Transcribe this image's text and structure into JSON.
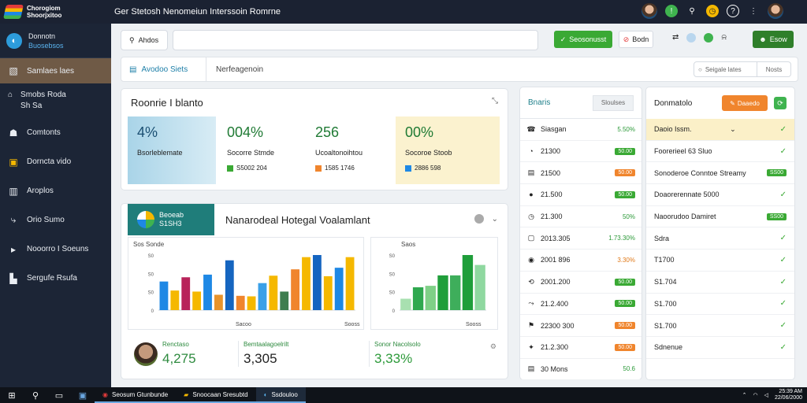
{
  "app": {
    "logo_line1": "Chorogiom",
    "logo_line2": "Shoorjxitoo",
    "title": "Ger Stetosh Nenomeiun Interssoin Romrne"
  },
  "topbar": {
    "icons": [
      "user-icon",
      "alert-icon",
      "pin-icon",
      "clock-icon",
      "help-icon",
      "more-icon"
    ]
  },
  "sidebar": {
    "user_name": "Donnotn",
    "user_sub": "Buosebsos",
    "items": [
      {
        "label": "Samlaes laes",
        "icon": "chart-icon"
      },
      {
        "label": "Smobs Roda",
        "label2": "Sh Sa",
        "icon": "inbox-icon"
      },
      {
        "label": "Comtonts",
        "icon": "users-icon"
      },
      {
        "label": "Dorncta vido",
        "icon": "image-icon"
      },
      {
        "label": "Aroplos",
        "icon": "bar-icon"
      },
      {
        "label": "Orio Sumo",
        "icon": "route-icon"
      },
      {
        "label": "Nooorro I Soeuns",
        "icon": "play-icon"
      },
      {
        "label": "Sergufe Rsufa",
        "icon": "building-icon"
      }
    ]
  },
  "toolbar": {
    "search_scope": "Ahdos",
    "search_placeholder": "",
    "primary_button": "Seosonusst",
    "secondary_button": "Bodn",
    "account_button": "Esow"
  },
  "tabs": {
    "tab1": "Avodoo Siets",
    "tab2": "Nerfeagenoin",
    "search_label": "Seigale lates",
    "search_right": "Nosts"
  },
  "report": {
    "title": "Roonrie I blanto",
    "kpis": [
      {
        "value": "4%",
        "label": "Bsorleblemate",
        "sub": ""
      },
      {
        "value": "004%",
        "label": "Socorre Stmde",
        "sub": "S5002 204"
      },
      {
        "value": "256",
        "label": "Ucoaltonoihtou",
        "sub": "1585 1746"
      },
      {
        "value": "00%",
        "label": "Socoroe Stoob",
        "sub": "2886 598"
      }
    ]
  },
  "chart": {
    "head_line1": "Beoeab",
    "head_line2": "S1SH3",
    "title": "Nanarodeal Hotegal Voalamlant",
    "plot1_title": "Sos Sonde",
    "plot1_xlabel1": "Sacoo",
    "plot1_xlabel2": "Sooss",
    "plot2_title": "Saos",
    "plot2_xlabel": "Sooss",
    "y_ticks1": [
      "S0",
      "S0",
      "S0",
      "0"
    ],
    "y_ticks2": [
      "S0",
      "S0",
      "S0",
      "0"
    ]
  },
  "chart_data": [
    {
      "type": "bar",
      "title": "Sos Sonde",
      "xlabel": "Sacoo",
      "ylabel": "",
      "ylim": [
        0,
        100
      ],
      "categories": [
        "1",
        "2",
        "3",
        "4",
        "5",
        "6",
        "7",
        "8",
        "9",
        "10",
        "11",
        "12",
        "13",
        "14",
        "15",
        "16",
        "17",
        "18"
      ],
      "values": [
        54,
        37,
        62,
        35,
        67,
        29,
        94,
        27,
        26,
        51,
        65,
        35,
        77,
        100,
        104,
        64,
        80,
        100
      ],
      "colors": [
        "#1e88e5",
        "#f5b800",
        "#b8235a",
        "#f5b800",
        "#1e88e5",
        "#e8932b",
        "#1565c0",
        "#f0852d",
        "#f5b800",
        "#3aa0e8",
        "#f5b800",
        "#3e7d4f",
        "#f0852d",
        "#f5b800",
        "#1565c0",
        "#f5b800",
        "#1e88e5",
        "#f5b800"
      ]
    },
    {
      "type": "bar",
      "title": "Saos",
      "xlabel": "Sooss",
      "ylabel": "",
      "ylim": [
        0,
        100
      ],
      "categories": [
        "1",
        "2",
        "3",
        "4",
        "5",
        "6",
        "7"
      ],
      "values": [
        23,
        46,
        49,
        70,
        70,
        111,
        91
      ],
      "colors": [
        "#a8e0b0",
        "#2fa84f",
        "#7fd087",
        "#1f9e3a",
        "#3eae5b",
        "#1f9e3a",
        "#8fd8a0"
      ]
    }
  ],
  "stats": [
    {
      "title": "Renctaso",
      "value": "4,275",
      "color": "#2d8a3e"
    },
    {
      "title": "Bemtaalagoelrilt",
      "value": "3,305",
      "color": "#222222"
    },
    {
      "title": "Sonor Nacolsolo",
      "value": "3,33%",
      "color": "#2d9a3a"
    }
  ],
  "list": {
    "title": "Bnaris",
    "head_button": "Sloulses",
    "rows": [
      {
        "icon": "☎",
        "name": "Siasgan",
        "value": "5.50%",
        "kind": "text-green"
      },
      {
        "icon": "◔",
        "name": "21300",
        "value": "50.00",
        "kind": "badge-green"
      },
      {
        "icon": "▤",
        "name": "21500",
        "value": "50.00",
        "kind": "badge-orange"
      },
      {
        "icon": "●",
        "name": "21.500",
        "value": "50.00",
        "kind": "badge-green"
      },
      {
        "icon": "◷",
        "name": "21.300",
        "value": "50%",
        "kind": "text-green"
      },
      {
        "icon": "▢",
        "name": "2013.305",
        "value": "1.73.30%",
        "kind": "text-green"
      },
      {
        "icon": "◉",
        "name": "2001 896",
        "value": "3.30%",
        "kind": "text-orange"
      },
      {
        "icon": "⟲",
        "name": "2001.200",
        "value": "50.00",
        "kind": "badge-green"
      },
      {
        "icon": "⤳",
        "name": "21.2.400",
        "value": "50.00",
        "kind": "badge-green"
      },
      {
        "icon": "⚑",
        "name": "22300 300",
        "value": "50.00",
        "kind": "badge-orange"
      },
      {
        "icon": "✦",
        "name": "21.2.300",
        "value": "50.00",
        "kind": "badge-orange"
      },
      {
        "icon": "▤",
        "name": "30 Mons",
        "value": "50.6",
        "kind": "text-green"
      }
    ]
  },
  "right": {
    "title": "Donmatolo",
    "orange_button": "Daaedo",
    "rows": [
      {
        "name": "Daoio Issm.",
        "badge": "",
        "check": "✓",
        "hl": true
      },
      {
        "name": "Foorerieel 63 Sluo",
        "badge": "",
        "check": "✓",
        "hl": false
      },
      {
        "name": "Sonoderoe Conntoe Streamy",
        "badge": "SS00",
        "check": "",
        "hl": false
      },
      {
        "name": "Doaorerennate 5000",
        "badge": "",
        "check": "✓",
        "hl": false
      },
      {
        "name": "Naoorudoo Damiret",
        "badge": "SS00",
        "check": "",
        "hl": false
      },
      {
        "name": "Sdra",
        "badge": "",
        "check": "✓",
        "hl": false
      },
      {
        "name": "T1700",
        "badge": "",
        "check": "✓",
        "hl": false
      },
      {
        "name": "S1.704",
        "badge": "",
        "check": "✓",
        "hl": false
      },
      {
        "name": "S1.700",
        "badge": "",
        "check": "✓",
        "hl": false
      },
      {
        "name": "S1.700",
        "badge": "",
        "check": "✓",
        "hl": false
      },
      {
        "name": "Sdnenue",
        "badge": "",
        "check": "✓",
        "hl": false
      }
    ]
  },
  "taskbar": {
    "apps": [
      {
        "label": "Seosum Gtunbunde",
        "icon": "browser-icon"
      },
      {
        "label": "Snoocaan Sresubtd",
        "icon": "folder-icon"
      },
      {
        "label": "Ssdouloo",
        "icon": "edge-icon"
      }
    ],
    "clock_line1": "25:39 AM",
    "clock_line2": "22/06/2000"
  }
}
